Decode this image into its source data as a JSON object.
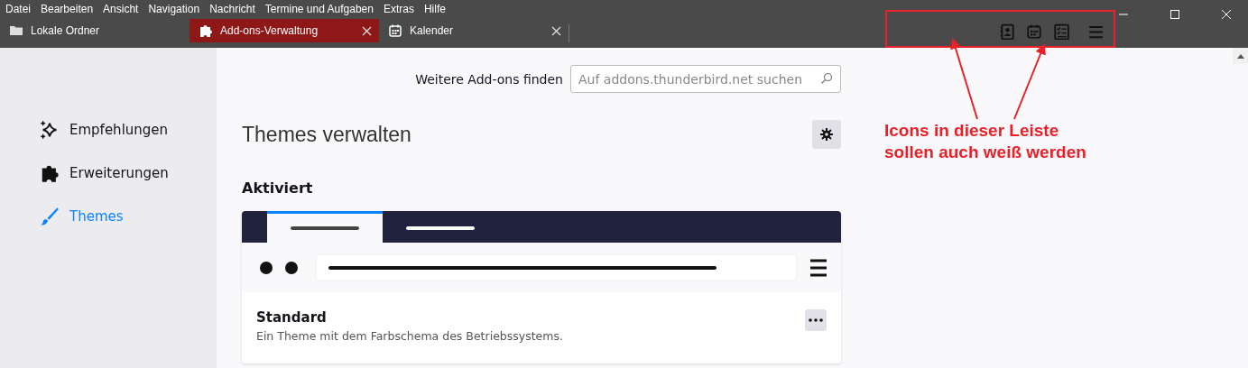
{
  "menu": [
    {
      "label": "Datei"
    },
    {
      "label": "Bearbeiten"
    },
    {
      "label": "Ansicht"
    },
    {
      "label": "Navigation"
    },
    {
      "label": "Nachricht"
    },
    {
      "label": "Termine und Aufgaben"
    },
    {
      "label": "Extras"
    },
    {
      "label": "Hilfe"
    }
  ],
  "tabs": [
    {
      "label": "Lokale Ordner",
      "kind": "folder",
      "selected": false,
      "closable": false
    },
    {
      "label": "Add-ons-Verwaltung",
      "kind": "puzzle",
      "selected": true,
      "closable": true
    },
    {
      "label": "Kalender",
      "kind": "calendar",
      "selected": false,
      "closable": true
    }
  ],
  "toolbar": [
    {
      "kind": "address-book"
    },
    {
      "kind": "calendar"
    },
    {
      "kind": "tasks"
    },
    {
      "kind": "menu"
    }
  ],
  "sidebar": {
    "items": [
      {
        "label": "Empfehlungen",
        "kind": "sparkle",
        "selected": false
      },
      {
        "label": "Erweiterungen",
        "kind": "puzzle",
        "selected": false
      },
      {
        "label": "Themes",
        "kind": "brush",
        "selected": true
      }
    ]
  },
  "search": {
    "label": "Weitere Add-ons finden",
    "placeholder": "Auf addons.thunderbird.net suchen"
  },
  "heading": "Themes verwalten",
  "section": {
    "title": "Aktiviert",
    "themes": [
      {
        "name": "Standard",
        "description": "Ein Theme mit dem Farbschema des Betriebssystems."
      }
    ]
  },
  "annotation": {
    "lines": [
      "Icons in dieser Leiste",
      "sollen auch weiß werden"
    ]
  }
}
